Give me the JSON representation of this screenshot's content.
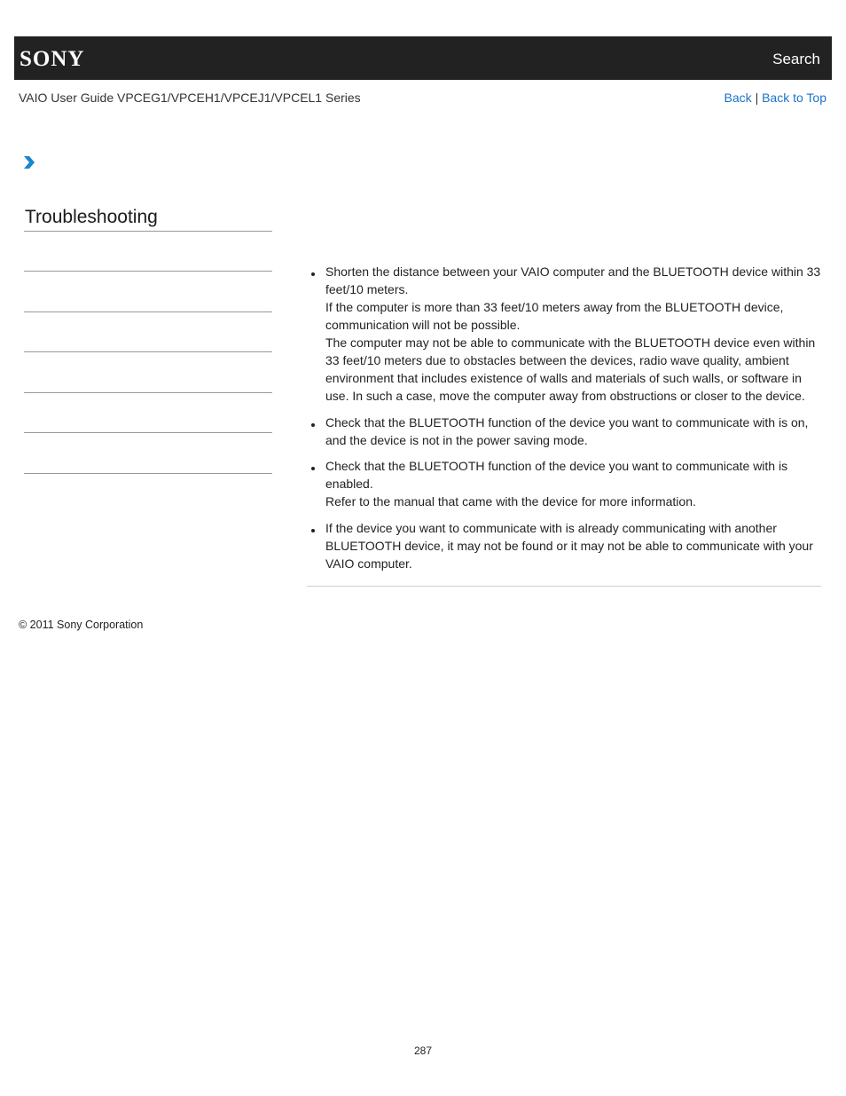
{
  "header": {
    "logo_text": "SONY",
    "search_label": "Search"
  },
  "subheader": {
    "guide_title": "VAIO User Guide VPCEG1/VPCEH1/VPCEJ1/VPCEL1 Series",
    "back_label": "Back",
    "separator": "|",
    "back_to_top_label": "Back to Top"
  },
  "breadcrumb": {
    "icon": "chevron-right-icon",
    "accent_color": "#1a87c9"
  },
  "sidebar": {
    "section_title": "Troubleshooting",
    "items": [
      "",
      "",
      "",
      "",
      "",
      ""
    ]
  },
  "content": {
    "bullets": [
      {
        "paragraphs": [
          "Shorten the distance between your VAIO computer and the BLUETOOTH device within 33 feet/10 meters.",
          "If the computer is more than 33 feet/10 meters away from the BLUETOOTH device, communication will not be possible.",
          "The computer may not be able to communicate with the BLUETOOTH device even within 33 feet/10 meters due to obstacles between the devices, radio wave quality, ambient environment that includes existence of walls and materials of such walls, or software in use. In such a case, move the computer away from obstructions or closer to the device."
        ]
      },
      {
        "paragraphs": [
          "Check that the BLUETOOTH function of the device you want to communicate with is on, and the device is not in the power saving mode."
        ]
      },
      {
        "paragraphs": [
          "Check that the BLUETOOTH function of the device you want to communicate with is enabled.",
          "Refer to the manual that came with the device for more information."
        ]
      },
      {
        "paragraphs": [
          "If the device you want to communicate with is already communicating with another BLUETOOTH device, it may not be found or it may not be able to communicate with your VAIO computer."
        ]
      }
    ]
  },
  "footer": {
    "copyright": "© 2011 Sony Corporation",
    "page_number": "287"
  }
}
